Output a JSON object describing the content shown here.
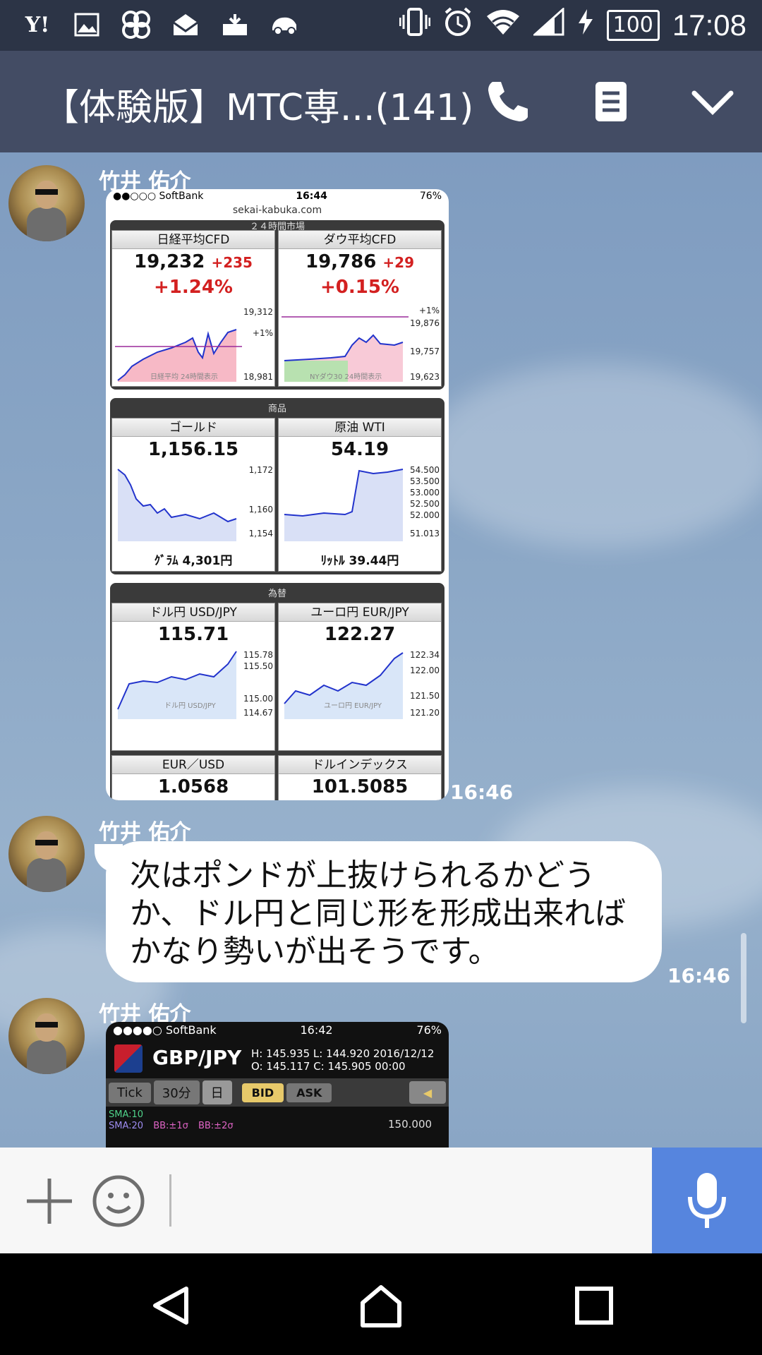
{
  "status_bar": {
    "left_icons": [
      "yahoo-icon",
      "image-icon",
      "pinwheel-icon",
      "mail-icon",
      "download-mail-icon",
      "car-icon"
    ],
    "yahoo_label": "Y!",
    "right_icons": [
      "vibrate-icon",
      "alarm-icon",
      "wifi-icon",
      "signal-icon",
      "charging-icon"
    ],
    "battery": "100",
    "time": "17:08"
  },
  "header": {
    "title": "【体験版】MTC専...(141)"
  },
  "messages": [
    {
      "sender": "竹井 佑介",
      "type": "image",
      "time": "16:46",
      "screenshot": {
        "carrier": "●●○○○ SoftBank",
        "time": "16:44",
        "battery": "76%",
        "url": "sekai-kabuka.com",
        "section_top_caption": "２４時間市場",
        "indices": [
          {
            "name": "日経平均CFD",
            "value": "19,232",
            "change": "+235",
            "pct": "+1.24%",
            "y_labels": [
              "19,312",
              "+1%",
              "18,981"
            ],
            "caption": "日経平均 24時間表示"
          },
          {
            "name": "ダウ平均CFD",
            "value": "19,786",
            "change": "+29",
            "pct": "+0.15%",
            "y_labels": [
              "+1%",
              "19,876",
              "19,757",
              "19,623"
            ],
            "caption": "NYダウ30 24時間表示"
          }
        ],
        "section_commodities": "商品",
        "commodities": [
          {
            "name": "ゴールド",
            "value": "1,156.15",
            "y_labels": [
              "1,172",
              "1,160",
              "1,154"
            ],
            "foot": "ｸﾞﾗﾑ 4,301円"
          },
          {
            "name": "原油 WTI",
            "value": "54.19",
            "y_labels": [
              "54.500",
              "53.500",
              "53.000",
              "52.500",
              "52.000",
              "51.013"
            ],
            "foot": "ﾘｯﾄﾙ 39.44円"
          }
        ],
        "section_fx": "為替",
        "fx": [
          {
            "name": "ドル円 USD/JPY",
            "value": "115.71",
            "y_labels": [
              "115.78",
              "115.50",
              "115.00",
              "114.67"
            ],
            "caption": "ドル円 USD/JPY"
          },
          {
            "name": "ユーロ円 EUR/JPY",
            "value": "122.27",
            "y_labels": [
              "122.34",
              "122.00",
              "121.50",
              "121.20"
            ],
            "caption": "ユーロ円 EUR/JPY"
          },
          {
            "name": "EUR／USD",
            "value": "1.0568"
          },
          {
            "name": "ドルインデックス",
            "value": "101.5085"
          }
        ]
      }
    },
    {
      "sender": "竹井 佑介",
      "type": "text",
      "time": "16:46",
      "lines": [
        "次はポンドが上抜けられるかどう",
        "か、ドル円と同じ形を形成出来れば",
        "かなり勢いが出そうです。"
      ]
    },
    {
      "sender": "竹井 佑介",
      "type": "image",
      "screenshot": {
        "carrier": "●●●●○ SoftBank",
        "time": "16:42",
        "battery": "76%",
        "pair": "GBP/JPY",
        "high": "H: 145.935",
        "low": "L: 144.920",
        "date": "2016/12/12",
        "open": "O: 145.117",
        "close": "C: 145.905",
        "clock": "00:00",
        "tabs": [
          "Tick",
          "30分",
          "日"
        ],
        "bid": "BID",
        "ask": "ASK",
        "sma10": "SMA:10",
        "sma20": "SMA:20",
        "bb1": "BB:±1σ",
        "bb2": "BB:±2σ",
        "price_label": "150.000"
      }
    }
  ],
  "colors": {
    "header_bg": "#434c64",
    "status_bg": "#2c3446",
    "mic_bg": "#5685de",
    "change_red": "#d32020"
  }
}
